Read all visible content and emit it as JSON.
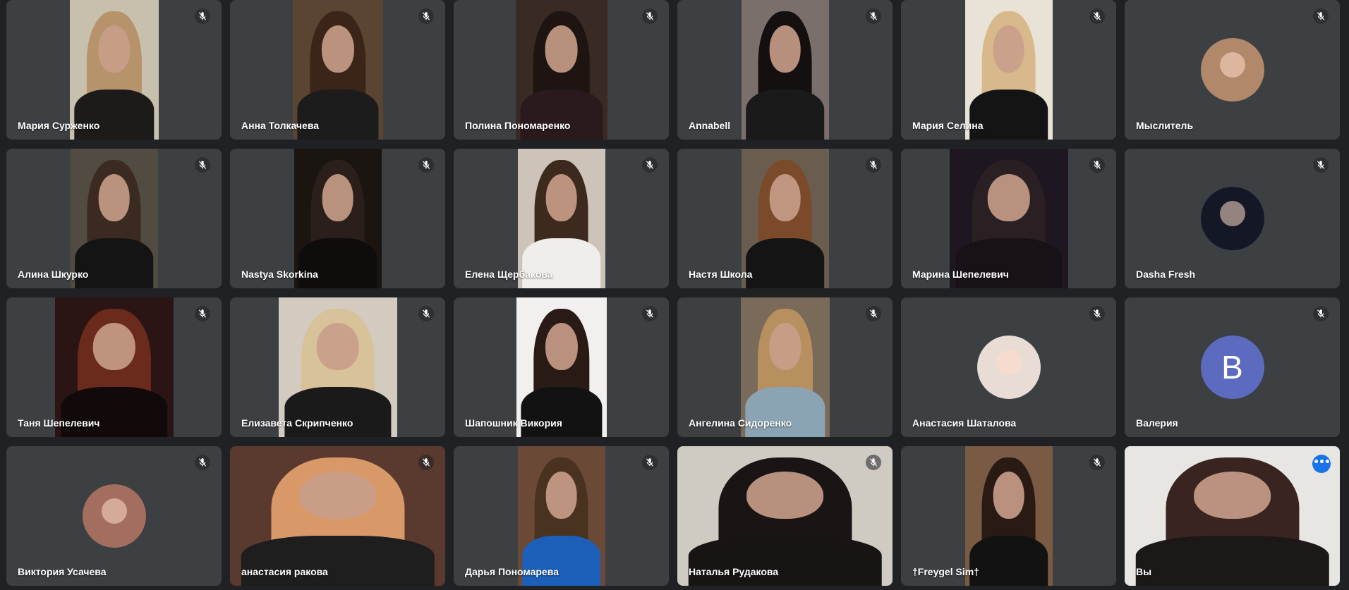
{
  "participants": [
    {
      "name": "Мария Сурженко",
      "type": "video",
      "bg": "#c7c0ac",
      "hair": "#b6936a",
      "torso": "#1d1a1a"
    },
    {
      "name": "Анна Толкачева",
      "type": "video",
      "bg": "#5a4432",
      "hair": "#3b2418",
      "torso": "#1c1c1c"
    },
    {
      "name": "Полина Пономаренко",
      "type": "video",
      "bg": "#3a2a24",
      "hair": "#1e1412",
      "torso": "#2a1a1e"
    },
    {
      "name": "Annabell",
      "type": "video",
      "bg": "#7a6f6a",
      "hair": "#141010",
      "torso": "#1a1a1a"
    },
    {
      "name": "Мария Селина",
      "type": "video",
      "bg": "#e9e2d6",
      "hair": "#d8b98c",
      "torso": "#141414"
    },
    {
      "name": "Мыслитель",
      "type": "avatar",
      "avatar_bg": "#b2886a",
      "icon": "profile-photo-boy-magazine"
    },
    {
      "name": "Алина Шкурко",
      "type": "video",
      "bg": "#514b41",
      "hair": "#3a2a22",
      "torso": "#141414"
    },
    {
      "name": "Nastya Skorkina",
      "type": "video",
      "bg": "#1b1512",
      "hair": "#2a1f1a",
      "torso": "#0f0c0c"
    },
    {
      "name": "Елена Щербакова",
      "type": "video",
      "bg": "#cdc3b8",
      "hair": "#3d2a1f",
      "torso": "#f0eeea"
    },
    {
      "name": "Настя Школа",
      "type": "video",
      "bg": "#6a5c4e",
      "hair": "#7a4a2a",
      "torso": "#141414"
    },
    {
      "name": "Марина Шепелевич",
      "type": "video",
      "bg": "#1e1620",
      "hair": "#2a2024",
      "torso": "#181218"
    },
    {
      "name": "Dasha Fresh",
      "type": "avatar",
      "avatar_bg": "#141826",
      "icon": "profile-photo-dark-anime"
    },
    {
      "name": "Таня Шепелевич",
      "type": "video",
      "bg": "#2a1414",
      "hair": "#6a2a1c",
      "torso": "#120a0a"
    },
    {
      "name": "Елизавета Скрипченко",
      "type": "video",
      "bg": "#d3cbc0",
      "hair": "#d8c29a",
      "torso": "#1a1a1a"
    },
    {
      "name": "Шапошник Викория",
      "type": "video",
      "bg": "#f2f0ee",
      "hair": "#2a1a16",
      "torso": "#121212"
    },
    {
      "name": "Ангелина Сидоренко",
      "type": "video",
      "bg": "#7a6a5a",
      "hair": "#b89060",
      "torso": "#8aa4b4"
    },
    {
      "name": "Анастасия Шаталова",
      "type": "avatar",
      "avatar_bg": "#e8dcd4",
      "icon": "profile-photo-crab-hat"
    },
    {
      "name": "Валерия",
      "type": "letter",
      "letter": "В",
      "avatar_bg": "#5c6bc0"
    },
    {
      "name": "Виктория Усачева",
      "type": "avatar",
      "avatar_bg": "#a46e5e",
      "icon": "profile-photo-girl"
    },
    {
      "name": "анастасия ракова",
      "type": "video-full",
      "bg": "#5a3a2e",
      "hair": "#d89868",
      "torso": "#1e1e1e"
    },
    {
      "name": "Дарья Пономарева",
      "type": "video",
      "bg": "#6a4a36",
      "hair": "#4a3220",
      "torso": "#1b5fb8"
    },
    {
      "name": "Наталья Рудакова",
      "type": "video-full",
      "bg": "#cfcac2",
      "hair": "#1a1414",
      "torso": "#181414"
    },
    {
      "name": "†Freygel Sim†",
      "type": "video",
      "bg": "#7a5a42",
      "hair": "#2a1a14",
      "torso": "#121212"
    },
    {
      "name": "Вы",
      "type": "video-self",
      "bg": "#e8e6e2",
      "hair": "#3a2420",
      "torso": "#1c1818"
    }
  ],
  "colors": {
    "background": "#202124",
    "tile": "#3c4043",
    "self_outline": "#8ab4f8",
    "more_button": "#1a73e8"
  },
  "icons": {
    "mic_muted": "mic-off-icon",
    "more_options": "more-options-icon"
  }
}
